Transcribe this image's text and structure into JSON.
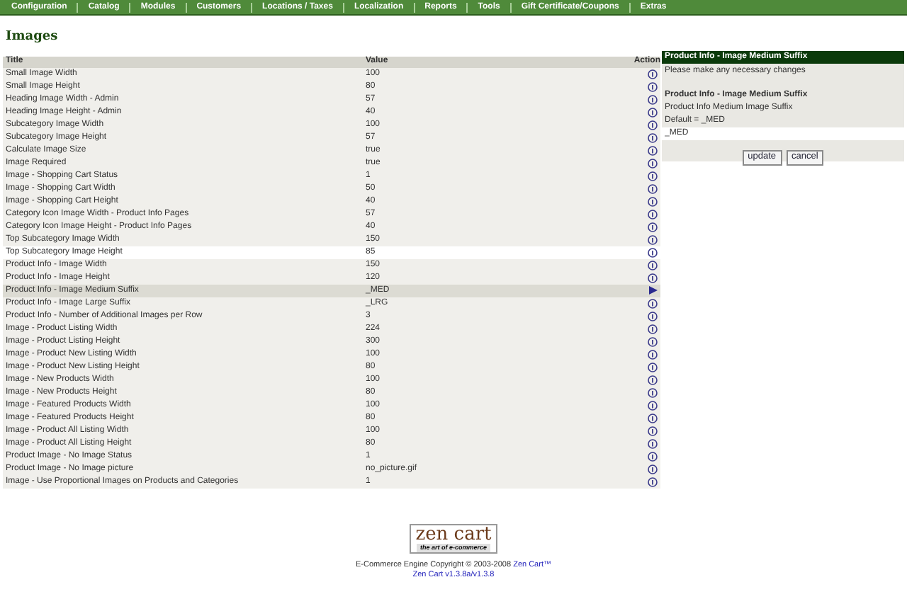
{
  "nav": [
    "Configuration",
    "Catalog",
    "Modules",
    "Customers",
    "Locations / Taxes",
    "Localization",
    "Reports",
    "Tools",
    "Gift Certificate/Coupons",
    "Extras"
  ],
  "page_title": "Images",
  "table": {
    "columns": [
      "Title",
      "Value",
      "Action"
    ],
    "rows": [
      {
        "title": "Small Image Width",
        "value": "100",
        "selected": false,
        "highlighted": false
      },
      {
        "title": "Small Image Height",
        "value": "80",
        "selected": false,
        "highlighted": false
      },
      {
        "title": "Heading Image Width - Admin",
        "value": "57",
        "selected": false,
        "highlighted": false
      },
      {
        "title": "Heading Image Height - Admin",
        "value": "40",
        "selected": false,
        "highlighted": false
      },
      {
        "title": "Subcategory Image Width",
        "value": "100",
        "selected": false,
        "highlighted": false
      },
      {
        "title": "Subcategory Image Height",
        "value": "57",
        "selected": false,
        "highlighted": false
      },
      {
        "title": "Calculate Image Size",
        "value": "true",
        "selected": false,
        "highlighted": false
      },
      {
        "title": "Image Required",
        "value": "true",
        "selected": false,
        "highlighted": false
      },
      {
        "title": "Image - Shopping Cart Status",
        "value": "1",
        "selected": false,
        "highlighted": false
      },
      {
        "title": "Image - Shopping Cart Width",
        "value": "50",
        "selected": false,
        "highlighted": false
      },
      {
        "title": "Image - Shopping Cart Height",
        "value": "40",
        "selected": false,
        "highlighted": false
      },
      {
        "title": "Category Icon Image Width - Product Info Pages",
        "value": "57",
        "selected": false,
        "highlighted": false
      },
      {
        "title": "Category Icon Image Height - Product Info Pages",
        "value": "40",
        "selected": false,
        "highlighted": false
      },
      {
        "title": "Top Subcategory Image Width",
        "value": "150",
        "selected": false,
        "highlighted": false
      },
      {
        "title": "Top Subcategory Image Height",
        "value": "85",
        "selected": false,
        "highlighted": true
      },
      {
        "title": "Product Info - Image Width",
        "value": "150",
        "selected": false,
        "highlighted": false
      },
      {
        "title": "Product Info - Image Height",
        "value": "120",
        "selected": false,
        "highlighted": false
      },
      {
        "title": "Product Info - Image Medium Suffix",
        "value": "_MED",
        "selected": true,
        "highlighted": false
      },
      {
        "title": "Product Info - Image Large Suffix",
        "value": "_LRG",
        "selected": false,
        "highlighted": false
      },
      {
        "title": "Product Info - Number of Additional Images per Row",
        "value": "3",
        "selected": false,
        "highlighted": false
      },
      {
        "title": "Image - Product Listing Width",
        "value": "224",
        "selected": false,
        "highlighted": false
      },
      {
        "title": "Image - Product Listing Height",
        "value": "300",
        "selected": false,
        "highlighted": false
      },
      {
        "title": "Image - Product New Listing Width",
        "value": "100",
        "selected": false,
        "highlighted": false
      },
      {
        "title": "Image - Product New Listing Height",
        "value": "80",
        "selected": false,
        "highlighted": false
      },
      {
        "title": "Image - New Products Width",
        "value": "100",
        "selected": false,
        "highlighted": false
      },
      {
        "title": "Image - New Products Height",
        "value": "80",
        "selected": false,
        "highlighted": false
      },
      {
        "title": "Image - Featured Products Width",
        "value": "100",
        "selected": false,
        "highlighted": false
      },
      {
        "title": "Image - Featured Products Height",
        "value": "80",
        "selected": false,
        "highlighted": false
      },
      {
        "title": "Image - Product All Listing Width",
        "value": "100",
        "selected": false,
        "highlighted": false
      },
      {
        "title": "Image - Product All Listing Height",
        "value": "80",
        "selected": false,
        "highlighted": false
      },
      {
        "title": "Product Image - No Image Status",
        "value": "1",
        "selected": false,
        "highlighted": false
      },
      {
        "title": "Product Image - No Image picture",
        "value": "no_picture.gif",
        "selected": false,
        "highlighted": false
      },
      {
        "title": "Image - Use Proportional Images on Products and Categories",
        "value": "1",
        "selected": false,
        "highlighted": false
      }
    ]
  },
  "edit_panel": {
    "header": "Product Info - Image Medium Suffix",
    "instructions": "Please make any necessary changes",
    "setting_title": "Product Info - Image Medium Suffix",
    "description": "Product Info Medium Image Suffix",
    "default": "Default = _MED",
    "value": "_MED",
    "buttons": [
      "update",
      "cancel"
    ]
  },
  "footer": {
    "logo_text": "zen cart",
    "logo_tagline": "the art of e-commerce",
    "copyright": "E-Commerce Engine Copyright © 2003-2008",
    "copyright_link": "Zen Cart™",
    "version": "Zen Cart v1.3.8a/v1.3.8"
  }
}
